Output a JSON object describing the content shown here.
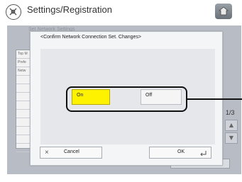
{
  "header": {
    "title": "Settings/Registration",
    "app_icon": "settings-gear-icon",
    "home_icon": "home-icon"
  },
  "background": {
    "title_faded": "Set Network Settings",
    "list_rows": [
      "Top M",
      "Prefe",
      "Netw",
      "",
      "",
      "",
      "",
      "",
      "",
      "",
      "",
      ""
    ],
    "page_indicator": "1/3",
    "scroll_up": "▲",
    "scroll_down": "▼"
  },
  "dialog": {
    "title": "<Confirm Network Connection Set. Changes>",
    "options": {
      "on_label": "On",
      "off_label": "Off",
      "selected": "On"
    },
    "cancel_label": "Cancel",
    "cancel_icon": "×",
    "ok_label": "OK"
  },
  "colors": {
    "selected": "#fff200",
    "panel": "#b8bcc4",
    "callout": "#111111"
  }
}
